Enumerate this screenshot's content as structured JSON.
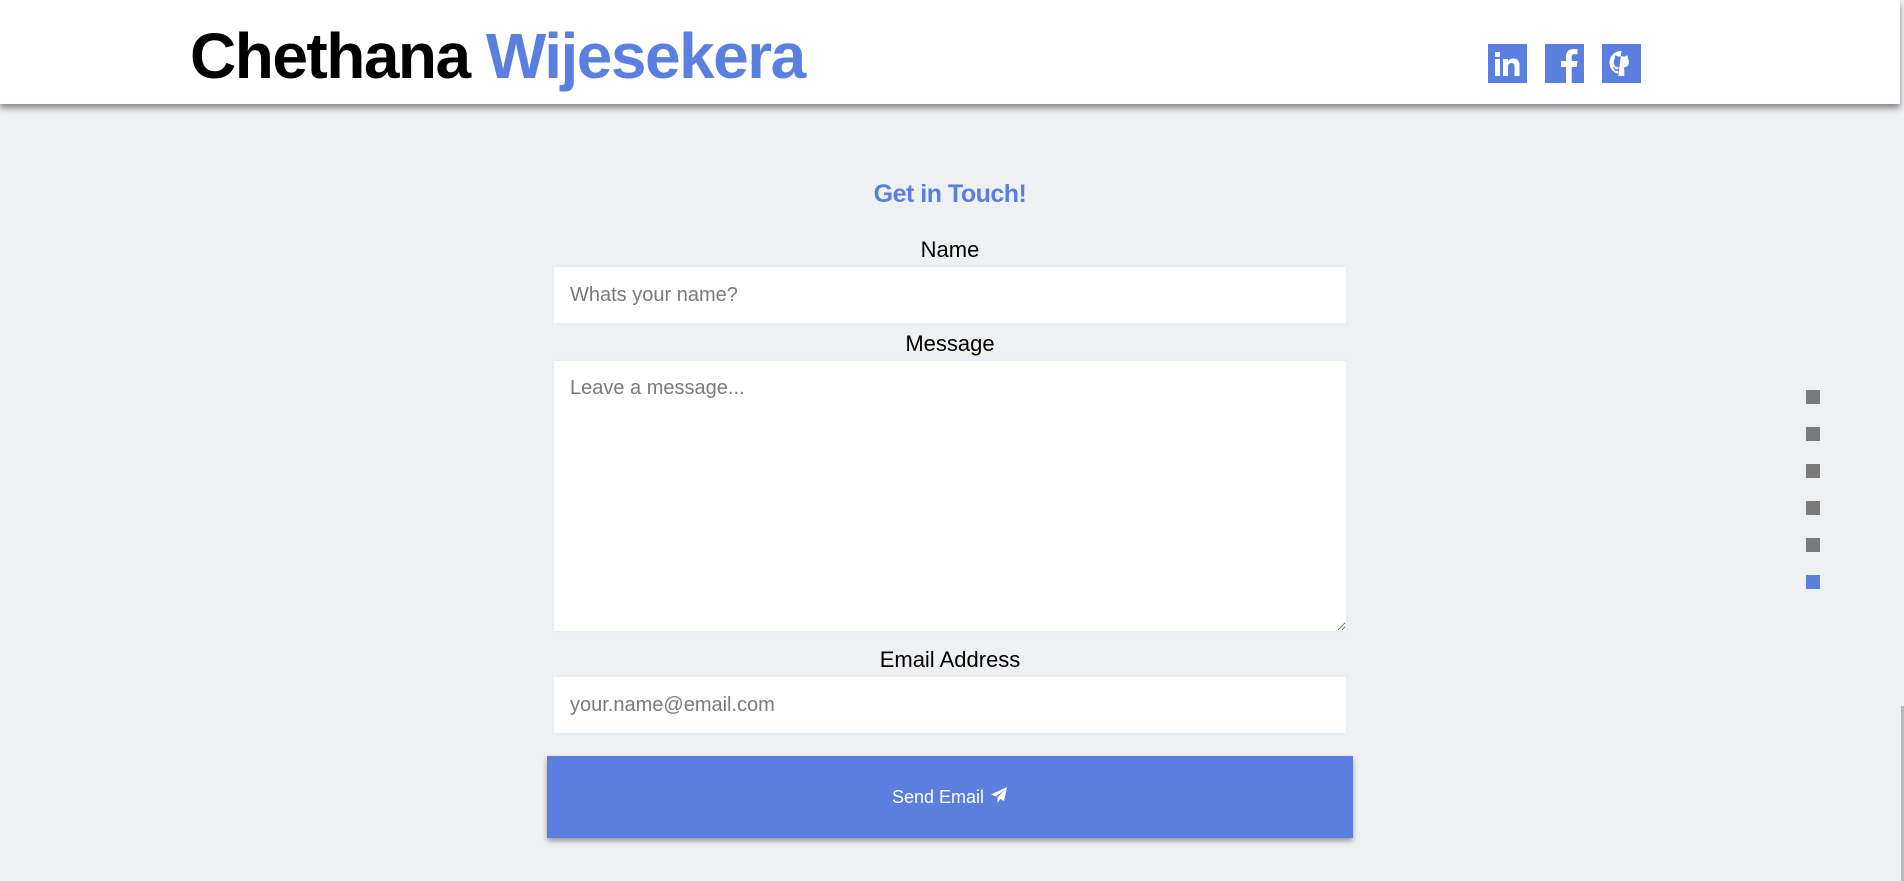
{
  "header": {
    "name_first": "Chethana",
    "name_last": "Wijesekera",
    "accent_color": "#5a7fdf",
    "social_links": [
      {
        "name": "linkedin",
        "icon": "linkedin-icon"
      },
      {
        "name": "facebook",
        "icon": "facebook-icon"
      },
      {
        "name": "github",
        "icon": "github-icon"
      }
    ]
  },
  "contact": {
    "title": "Get in Touch!",
    "name_label": "Name",
    "name_placeholder": "Whats your name?",
    "message_label": "Message",
    "message_placeholder": "Leave a message...",
    "email_label": "Email Address",
    "email_placeholder": "your.name@email.com",
    "send_label": "Send Email",
    "send_icon": "paper-plane-icon"
  },
  "section_nav": {
    "count": 6,
    "active_index": 5,
    "dot_color": "#7a7a7a",
    "active_color": "#5a7fdf"
  },
  "colors": {
    "background": "#eff0f2",
    "header_background": "#ffffff",
    "accent": "#5a7fdf"
  }
}
